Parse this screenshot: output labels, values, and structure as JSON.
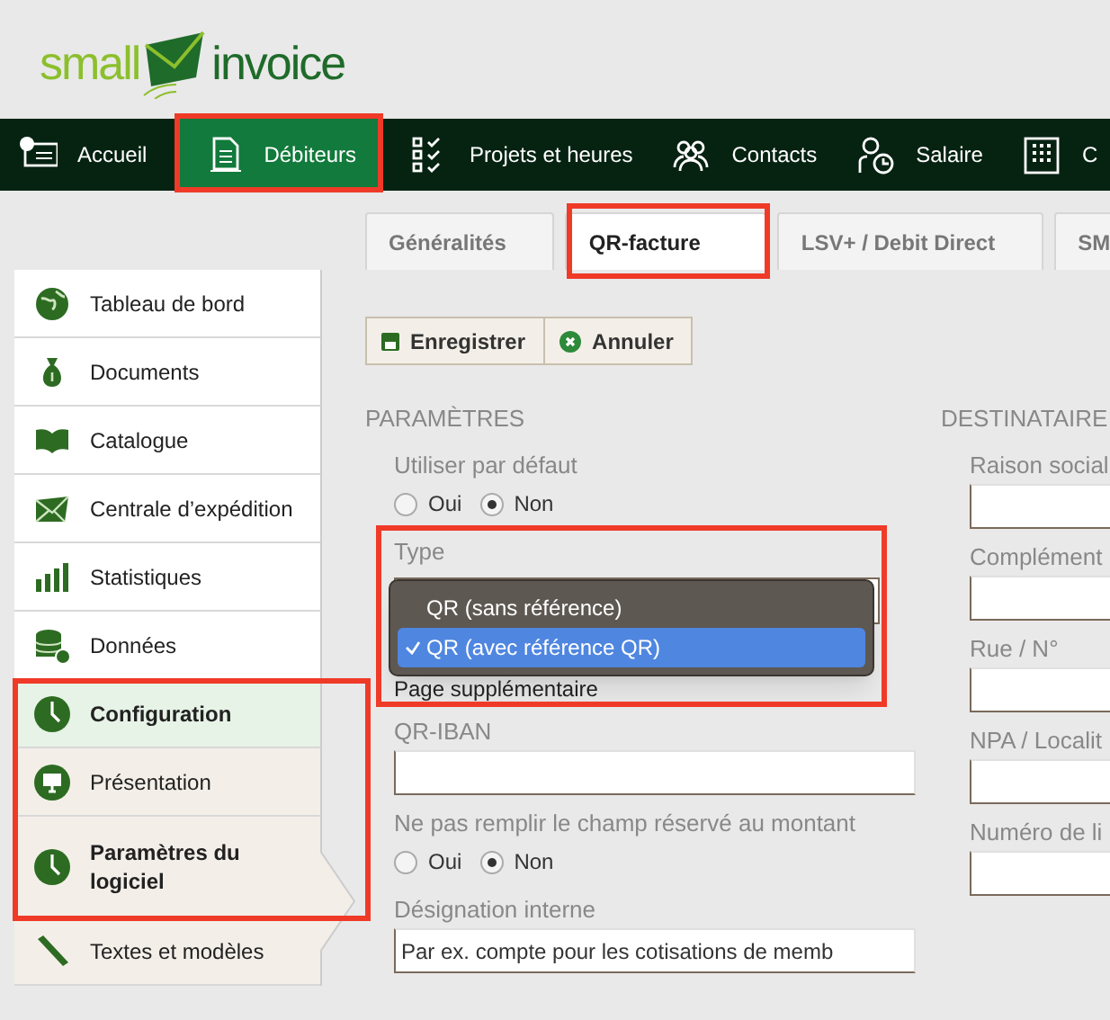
{
  "logo": {
    "part_1": "small",
    "part_2": "invoice"
  },
  "nav": [
    {
      "label": "Accueil",
      "selected": false
    },
    {
      "label": "Débiteurs",
      "selected": true
    },
    {
      "label": "Projets et heures",
      "selected": false
    },
    {
      "label": "Contacts",
      "selected": false
    },
    {
      "label": "Salaire",
      "selected": false
    },
    {
      "label": "C",
      "selected": false
    }
  ],
  "tabs": [
    {
      "label": "Généralités",
      "selected": false
    },
    {
      "label": "QR-facture",
      "selected": true
    },
    {
      "label": "LSV+ / Debit Direct",
      "selected": false
    },
    {
      "label": "SM",
      "selected": false
    }
  ],
  "sidebar": [
    {
      "label": "Tableau de bord",
      "selected": false,
      "group": false
    },
    {
      "label": "Documents",
      "selected": false,
      "group": false
    },
    {
      "label": "Catalogue",
      "selected": false,
      "group": false
    },
    {
      "label": "Centrale d’expédition",
      "selected": false,
      "group": false
    },
    {
      "label": "Statistiques",
      "selected": false,
      "group": false
    },
    {
      "label": "Données",
      "selected": false,
      "group": false
    },
    {
      "label": "Configuration",
      "selected": true,
      "group": false
    },
    {
      "label": "Présentation",
      "selected": false,
      "group": true
    },
    {
      "label": "Paramètres du logiciel",
      "selected": true,
      "group": true
    },
    {
      "label": "Textes et modèles",
      "selected": false,
      "group": true
    }
  ],
  "toolbar": [
    "Enregistrer",
    "Annuler"
  ],
  "left_section": {
    "heading": "PARAMÈTRES",
    "fields": [
      {
        "kind": "radio",
        "label": "Utiliser par défaut",
        "options": [
          {
            "label": "Oui",
            "selected": false
          },
          {
            "label": "Non",
            "selected": true
          }
        ]
      },
      {
        "kind": "select",
        "label": "Type",
        "options": [
          {
            "label": "QR (sans référence)",
            "selected": false
          },
          {
            "label": "QR (avec référence QR)",
            "selected": true
          }
        ]
      },
      {
        "kind": "note",
        "text": "Page supplémentaire"
      },
      {
        "kind": "text",
        "label": "QR-IBAN"
      },
      {
        "kind": "radio",
        "label": "Ne pas remplir le champ réservé au montant",
        "options": [
          {
            "label": "Oui",
            "selected": false
          },
          {
            "label": "Non",
            "selected": true
          }
        ]
      },
      {
        "kind": "text",
        "label": "Désignation interne",
        "placeholder": "Par ex. compte pour les cotisations de memb"
      }
    ]
  },
  "right_section": {
    "heading": "DESTINATAIRE",
    "fields": [
      {
        "kind": "text",
        "label": "Raison social"
      },
      {
        "kind": "text",
        "label": "Complément"
      },
      {
        "kind": "text",
        "label": "Rue / N°"
      },
      {
        "kind": "text",
        "label": "NPA / Localit"
      },
      {
        "kind": "text",
        "label": "Numéro de li"
      }
    ]
  }
}
